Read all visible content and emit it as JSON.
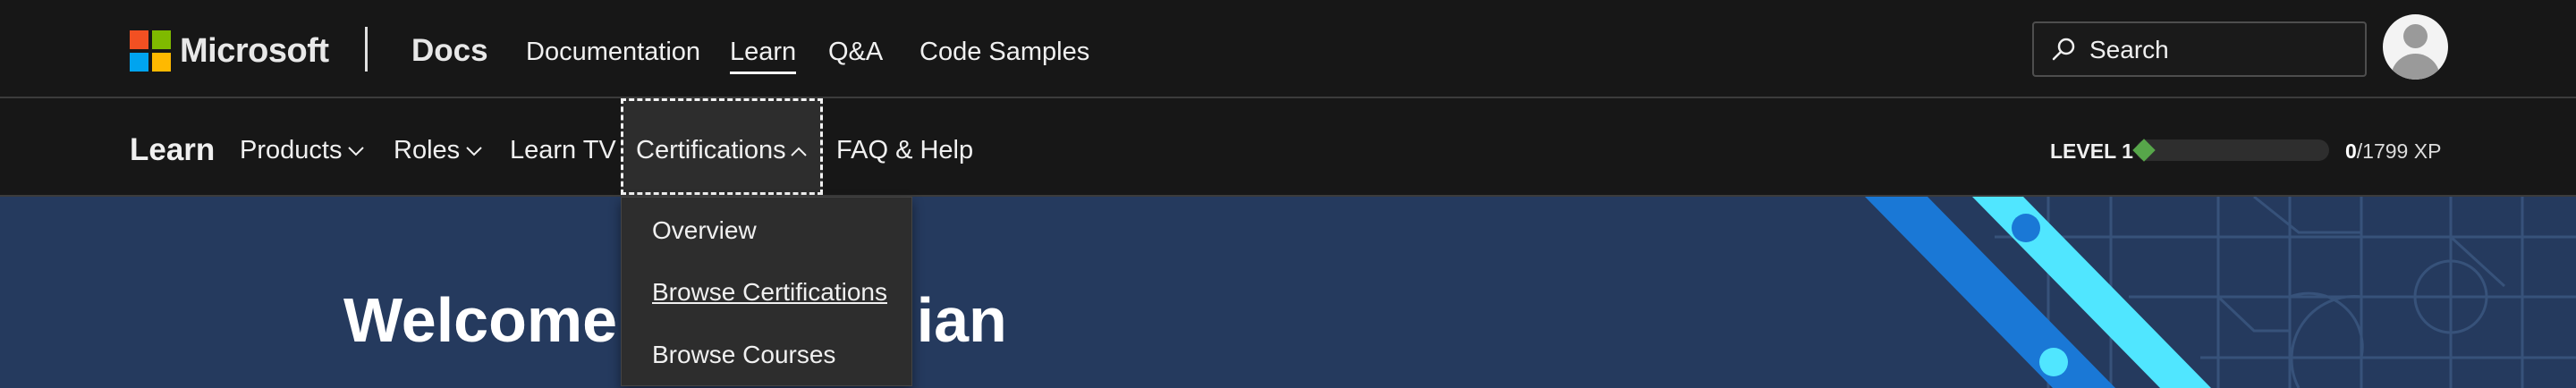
{
  "header": {
    "brand": "Microsoft",
    "site_title": "Docs",
    "nav": [
      {
        "label": "Documentation",
        "active": false
      },
      {
        "label": "Learn",
        "active": true
      },
      {
        "label": "Q&A",
        "active": false
      },
      {
        "label": "Code Samples",
        "active": false
      }
    ],
    "search_placeholder": "Search"
  },
  "subnav": {
    "brand": "Learn",
    "items": [
      {
        "label": "Products",
        "has_dropdown": true
      },
      {
        "label": "Roles",
        "has_dropdown": true
      },
      {
        "label": "Learn TV",
        "has_dropdown": false
      },
      {
        "label": "Certifications",
        "has_dropdown": true,
        "expanded": true
      },
      {
        "label": "FAQ & Help",
        "has_dropdown": false
      }
    ],
    "level": "LEVEL 1",
    "xp_current": "0",
    "xp_total": "/1799 XP",
    "xp_progress": 0
  },
  "dropdown": {
    "items": [
      "Overview",
      "Browse Certifications",
      "Browse Courses"
    ]
  },
  "hero": {
    "greeting": "Welcome Charles Jian"
  },
  "colors": {
    "header_bg": "#171717",
    "hero_bg": "#253a5e",
    "xp_green": "#57a64a",
    "stripe_blue": "#1a78d6",
    "stripe_cyan": "#50e6ff"
  }
}
